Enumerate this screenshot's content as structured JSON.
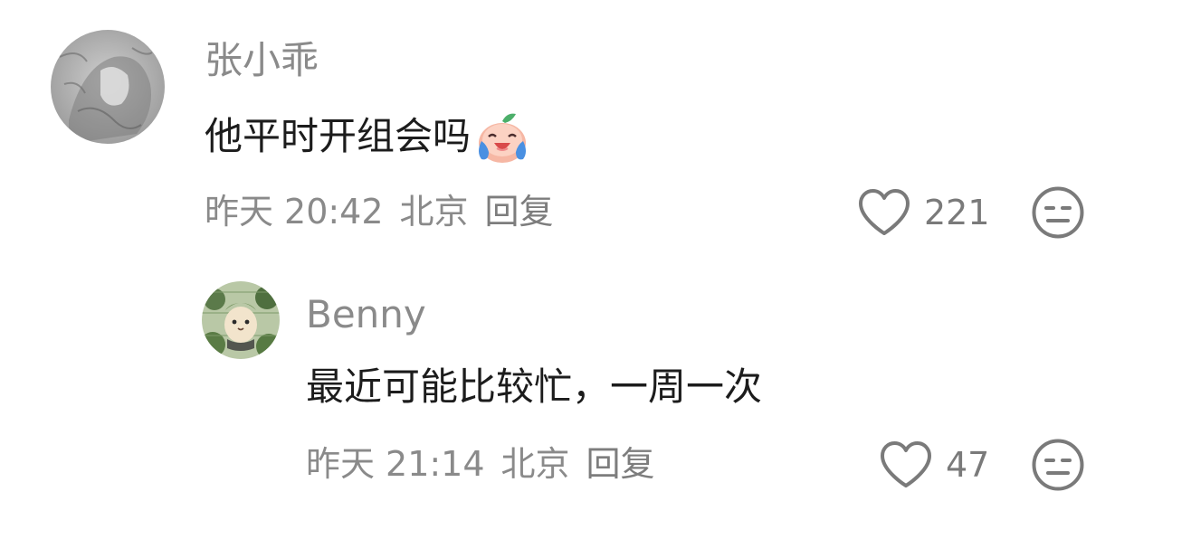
{
  "comments": [
    {
      "username": "张小乖",
      "text": "他平时开组会吗",
      "emoji_icon": "laughing-crying-peach-emoji-icon",
      "date": "昨天",
      "time": "20:42",
      "location": "北京",
      "reply_label": "回复",
      "likes": "221"
    },
    {
      "username": "Benny",
      "text": "最近可能比较忙，一周一次",
      "date": "昨天",
      "time": "21:14",
      "location": "北京",
      "reply_label": "回复",
      "likes": "47"
    }
  ],
  "icons": {
    "like": "heart-outline-icon",
    "dislike": "meh-face-icon"
  },
  "colors": {
    "secondary_text": "#8a8a8a",
    "primary_text": "#1c1c1c"
  }
}
